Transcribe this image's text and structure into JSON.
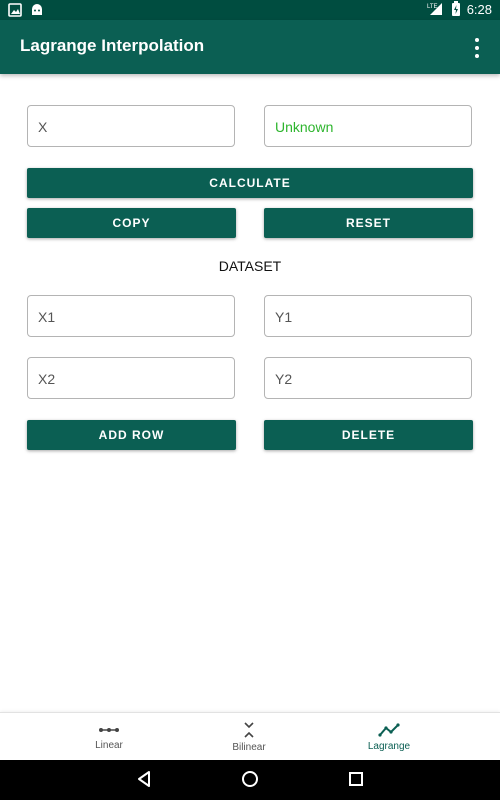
{
  "status_bar": {
    "time": "6:28",
    "network": "LTE",
    "background": "#004d40"
  },
  "app_bar": {
    "title": "Lagrange Interpolation",
    "color": "#0b5f53",
    "overflow_icon": "more-vert-icon"
  },
  "input": {
    "x_placeholder": "X",
    "result_text": "Unknown",
    "result_color": "#2eb52e"
  },
  "buttons": {
    "calculate": "CALCULATE",
    "copy": "COPY",
    "reset": "RESET",
    "add_row": "ADD ROW",
    "delete": "DELETE"
  },
  "dataset": {
    "title": "DATASET",
    "rows": [
      {
        "x": "X1",
        "y": "Y1"
      },
      {
        "x": "X2",
        "y": "Y2"
      }
    ]
  },
  "bottom_nav": {
    "items": [
      {
        "label": "Linear",
        "icon": "linear-icon",
        "active": false
      },
      {
        "label": "Bilinear",
        "icon": "bilinear-icon",
        "active": false
      },
      {
        "label": "Lagrange",
        "icon": "lagrange-icon",
        "active": true
      }
    ]
  }
}
